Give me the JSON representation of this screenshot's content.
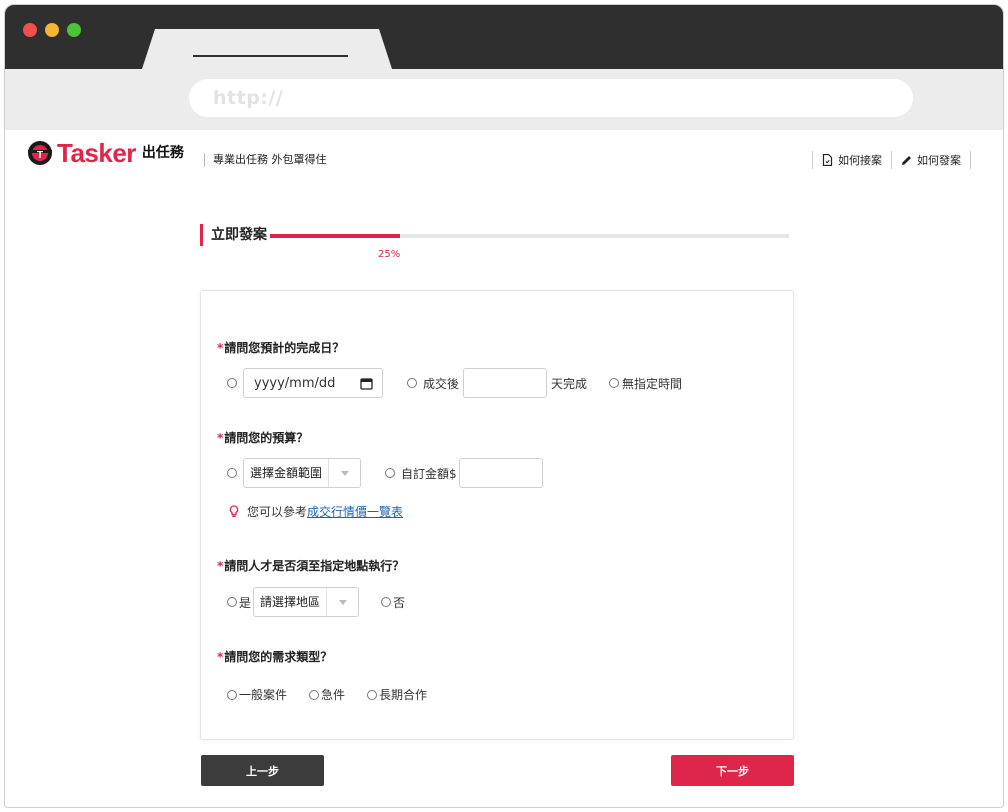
{
  "browser": {
    "url": "http://"
  },
  "site": {
    "logo_text": "Tasker",
    "logo_cn": "出任務",
    "tagline": "專業出任務 外包罩得住",
    "nav": [
      {
        "label": "如何接案",
        "icon": "document-icon"
      },
      {
        "label": "如何發案",
        "icon": "pencil-icon"
      }
    ]
  },
  "progress": {
    "title": "立即發案",
    "percent_label": "25%",
    "value": 0.25
  },
  "form": {
    "q1": {
      "required_mark": "*",
      "label": "請問您預計的完成日？",
      "date_placeholder": "yyyy/mm/dd",
      "after_deal_label": "成交後",
      "days_suffix": "天完成",
      "no_time_label": "無指定時間"
    },
    "q2": {
      "required_mark": "*",
      "label": "請問您的預算？",
      "range_select": "選擇金額範圍",
      "custom_label": "自訂金額$",
      "tip_prefix": "您可以參考",
      "tip_link": "成交行情價一覽表"
    },
    "q3": {
      "required_mark": "*",
      "label": "請問人才是否須至指定地點執行？",
      "yes_label": "是",
      "region_select": "請選擇地區",
      "no_label": "否"
    },
    "q4": {
      "required_mark": "*",
      "label": "請問您的需求類型？",
      "options": [
        "一般案件",
        "急件",
        "長期合作"
      ]
    }
  },
  "buttons": {
    "prev": "上一步",
    "next": "下一步"
  },
  "colors": {
    "accent": "#e0254a",
    "dark": "#3c3c3c",
    "link": "#1a62b3"
  }
}
